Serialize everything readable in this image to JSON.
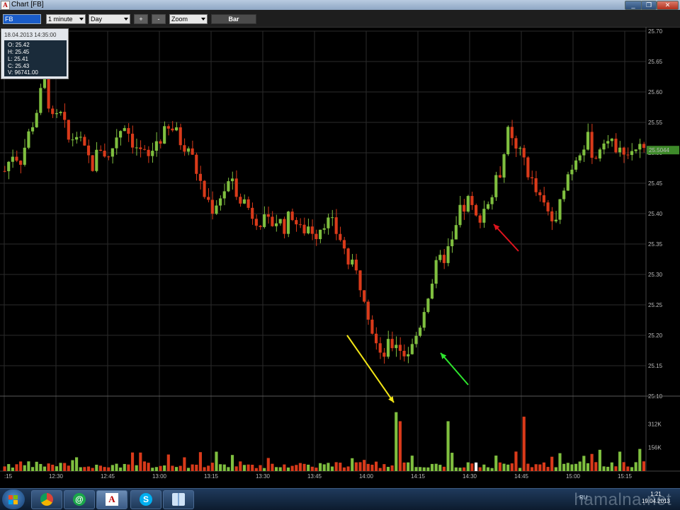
{
  "window": {
    "title": "Chart [FB]",
    "app_icon": "A",
    "minimize": "_",
    "restore": "❐",
    "close": "✕"
  },
  "toolbar": {
    "symbol": "FB",
    "interval": "1 minute",
    "period": "Day",
    "zoom_in": "+",
    "zoom_out": "-",
    "zoom": "Zoom",
    "chart_type": "Bar"
  },
  "info_panel": {
    "date": "18.04.2013 14:35:00",
    "open": "O: 25.42",
    "high": "H: 25.45",
    "low": "L: 25.41",
    "close": "C: 25.43",
    "volume": "V: 96741.00"
  },
  "price_axis": [
    "25.70",
    "25.65",
    "25.60",
    "25.55",
    "25.50",
    "25.45",
    "25.40",
    "25.35",
    "25.30",
    "25.25",
    "25.20",
    "25.15",
    "25.10"
  ],
  "current_price": "25.5044",
  "volume_axis": [
    "312K",
    "156K"
  ],
  "time_axis": [
    ":15",
    "12:30",
    "12:45",
    "13:00",
    "13:15",
    "13:30",
    "13:45",
    "14:00",
    "14:15",
    "14:30",
    "14:45",
    "15:00",
    "15:15"
  ],
  "colors": {
    "up": "#7fbf3f",
    "down": "#d93a1a",
    "grid": "#2b2b2b",
    "background": "#000000",
    "arrow_yellow": "#f2e516",
    "arrow_green": "#2ee62e",
    "arrow_red": "#e0141e",
    "current_price_tag": "#3e8a2a"
  },
  "taskbar": {
    "items": [
      "start-button",
      "chrome-icon",
      "mail-agent-icon",
      "chart-app-icon",
      "skype-icon",
      "book-icon"
    ],
    "lang": "RU",
    "time": "1:21",
    "date": "19.04.2013"
  },
  "watermark": "hamalna.net",
  "chart_data": {
    "type": "bar",
    "title": "",
    "xlabel": "",
    "ylabel": "",
    "symbol": "FB",
    "interval": "1 minute",
    "ylim": [
      25.1,
      25.7
    ],
    "volume_ylim": [
      0,
      468000
    ],
    "x_ticks": [
      "12:30",
      "12:45",
      "13:00",
      "13:15",
      "13:30",
      "13:45",
      "14:00",
      "14:15",
      "14:30",
      "14:45",
      "15:00",
      "15:15"
    ],
    "price_path": [
      [
        0,
        25.47
      ],
      [
        2,
        25.5
      ],
      [
        4,
        25.49
      ],
      [
        6,
        25.53
      ],
      [
        8,
        25.57
      ],
      [
        10,
        25.62
      ],
      [
        12,
        25.55
      ],
      [
        14,
        25.56
      ],
      [
        16,
        25.52
      ],
      [
        18,
        25.53
      ],
      [
        20,
        25.5
      ],
      [
        22,
        25.48
      ],
      [
        24,
        25.51
      ],
      [
        26,
        25.49
      ],
      [
        28,
        25.53
      ],
      [
        30,
        25.55
      ],
      [
        32,
        25.52
      ],
      [
        34,
        25.5
      ],
      [
        36,
        25.49
      ],
      [
        38,
        25.52
      ],
      [
        40,
        25.53
      ],
      [
        42,
        25.54
      ],
      [
        44,
        25.52
      ],
      [
        46,
        25.51
      ],
      [
        48,
        25.47
      ],
      [
        50,
        25.43
      ],
      [
        52,
        25.41
      ],
      [
        54,
        25.43
      ],
      [
        56,
        25.45
      ],
      [
        58,
        25.44
      ],
      [
        60,
        25.42
      ],
      [
        62,
        25.4
      ],
      [
        64,
        25.39
      ],
      [
        66,
        25.38
      ],
      [
        68,
        25.39
      ],
      [
        70,
        25.38
      ],
      [
        72,
        25.4
      ],
      [
        74,
        25.37
      ],
      [
        76,
        25.38
      ],
      [
        78,
        25.37
      ],
      [
        80,
        25.39
      ],
      [
        82,
        25.38
      ],
      [
        84,
        25.36
      ],
      [
        86,
        25.32
      ],
      [
        88,
        25.3
      ],
      [
        90,
        25.27
      ],
      [
        92,
        25.21
      ],
      [
        94,
        25.16
      ],
      [
        96,
        25.18
      ],
      [
        98,
        25.19
      ],
      [
        100,
        25.17
      ],
      [
        102,
        25.18
      ],
      [
        104,
        25.22
      ],
      [
        106,
        25.27
      ],
      [
        108,
        25.31
      ],
      [
        110,
        25.33
      ],
      [
        112,
        25.35
      ],
      [
        114,
        25.4
      ],
      [
        116,
        25.42
      ],
      [
        118,
        25.39
      ],
      [
        120,
        25.41
      ],
      [
        122,
        25.43
      ],
      [
        124,
        25.47
      ],
      [
        126,
        25.53
      ],
      [
        128,
        25.5
      ],
      [
        130,
        25.49
      ],
      [
        132,
        25.45
      ],
      [
        134,
        25.42
      ],
      [
        136,
        25.4
      ],
      [
        138,
        25.38
      ],
      [
        140,
        25.45
      ],
      [
        142,
        25.48
      ],
      [
        144,
        25.51
      ],
      [
        146,
        25.52
      ],
      [
        148,
        25.49
      ],
      [
        150,
        25.53
      ],
      [
        152,
        25.51
      ],
      [
        154,
        25.52
      ],
      [
        156,
        25.5
      ],
      [
        158,
        25.51
      ],
      [
        160,
        25.5
      ]
    ],
    "price_range_start": "12:15",
    "price_range_end": "15:20",
    "volume_spikes": [
      {
        "time": "14:08",
        "volume": 390000
      },
      {
        "time": "14:09",
        "volume": 330000
      },
      {
        "time": "14:22",
        "volume": 330000
      },
      {
        "time": "14:44",
        "volume": 360000
      }
    ],
    "annotations": [
      {
        "color": "yellow",
        "points_to": "volume spike at 14:08"
      },
      {
        "color": "green",
        "points_to": "price low near 25.17 at 14:21"
      },
      {
        "color": "red",
        "points_to": "price near 25.38 at 14:37"
      }
    ],
    "current_price": 25.5044
  }
}
